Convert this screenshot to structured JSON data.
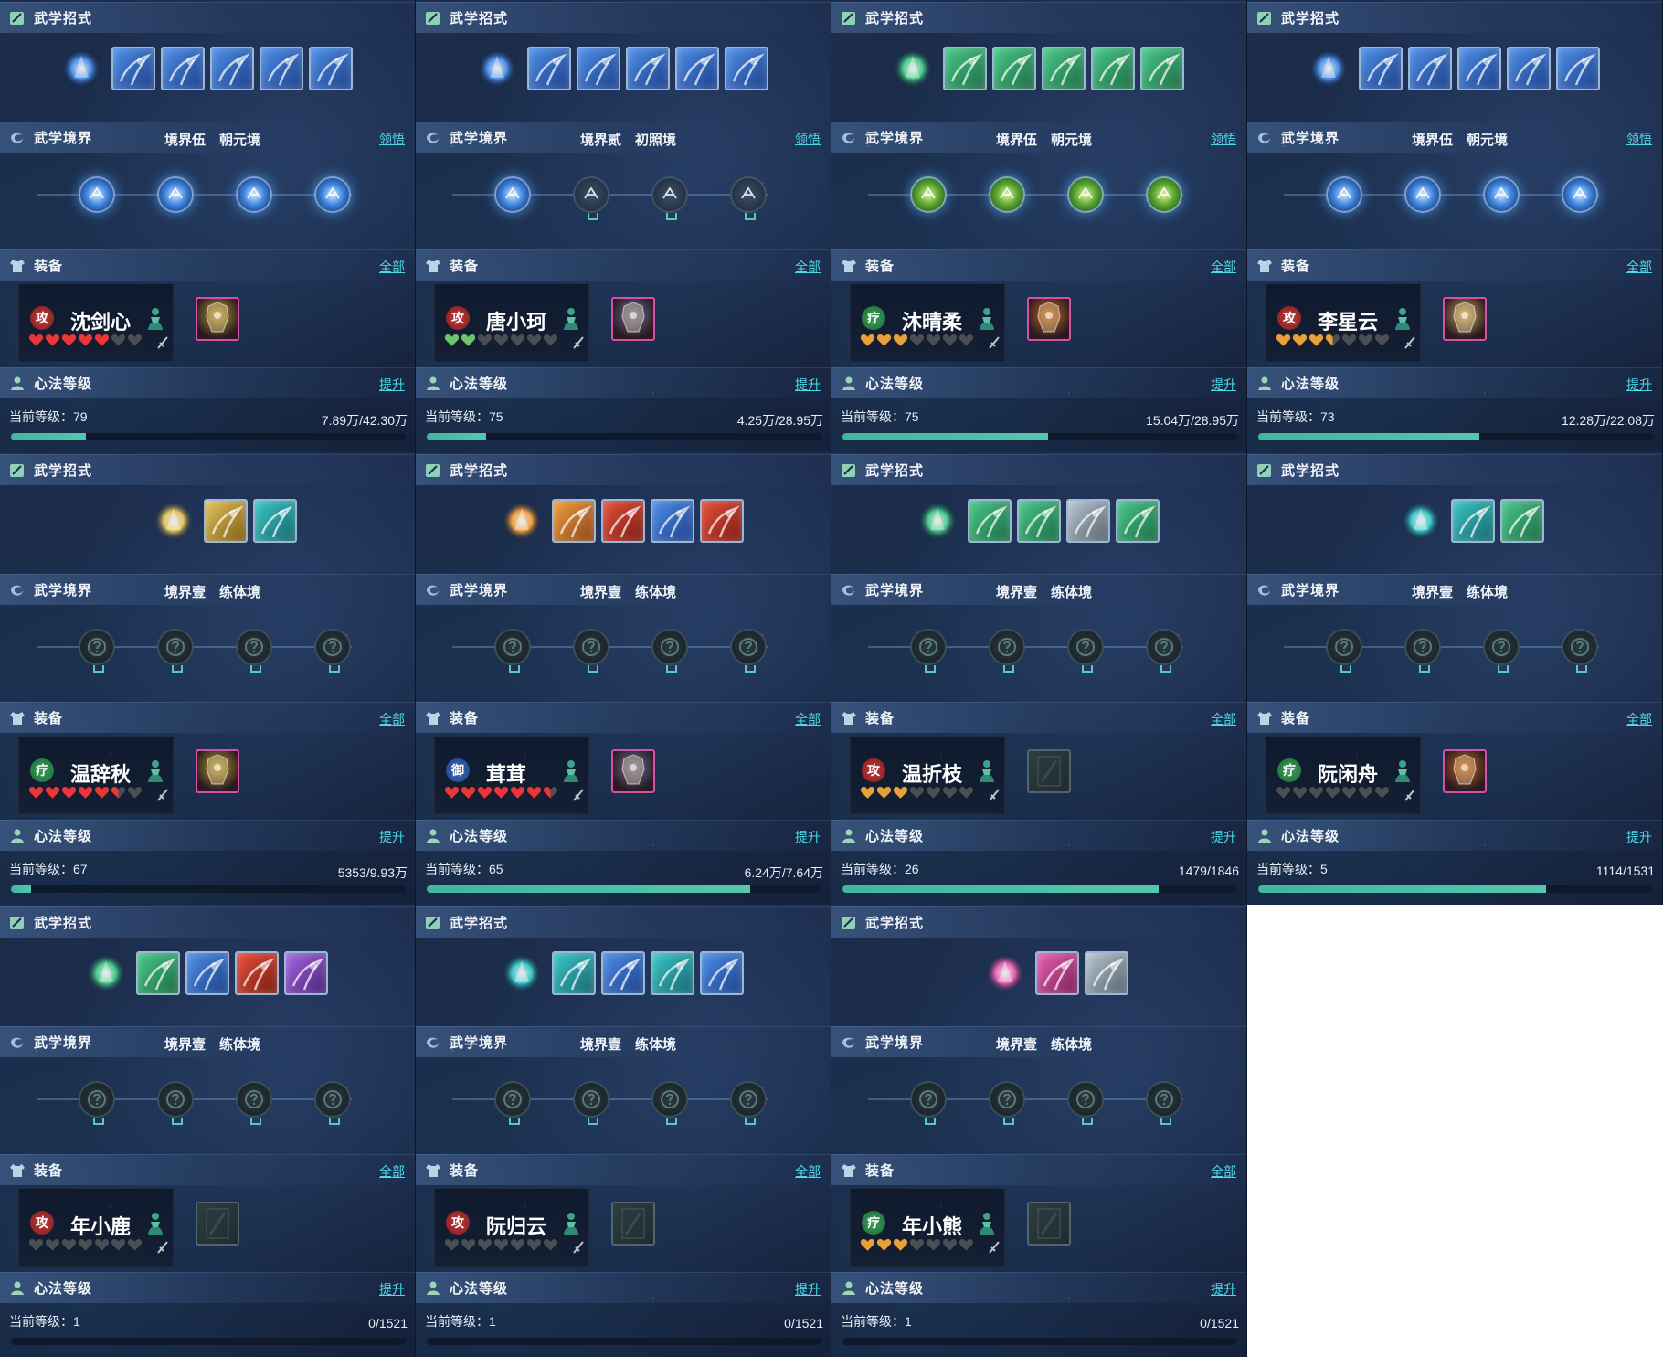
{
  "labels": {
    "skills": "武学招式",
    "realm": "武学境界",
    "realm_link": "领悟",
    "equip": "装备",
    "equip_link": "全部",
    "heart_method": "心法等级",
    "heart_link": "提升",
    "level_prefix": "当前等级："
  },
  "colors": {
    "accent_link": "#4fd9e8",
    "progress_fill": "#4fbfa6",
    "heart_red": "#e8383a",
    "heart_green": "#6ec46a",
    "heart_gold": "#e7a13a",
    "heart_empty": "#4a4f57"
  },
  "panels": [
    {
      "name": "沈剑心",
      "role": "attack",
      "role_char": "攻",
      "realm": "境界伍",
      "realm_stage": "朝元境",
      "show_realm_link": true,
      "level": "79",
      "exp": "7.89万/42.30万",
      "progress": 0.19,
      "hearts": {
        "filled": 5,
        "half": 0,
        "total": 7,
        "color": "red"
      },
      "armor": "has",
      "armor_color": "#b39a30",
      "char_icon": "ice-orb",
      "skill_icons": [
        "blue",
        "blue",
        "blue",
        "blue",
        "blue"
      ],
      "realm_nodes": [
        "active",
        "active",
        "active",
        "active"
      ]
    },
    {
      "name": "唐小珂",
      "role": "attack",
      "role_char": "攻",
      "realm": "境界贰",
      "realm_stage": "初照境",
      "show_realm_link": true,
      "level": "75",
      "exp": "4.25万/28.95万",
      "progress": 0.15,
      "hearts": {
        "filled": 2,
        "half": 0,
        "total": 7,
        "color": "green"
      },
      "armor": "has",
      "armor_color": "#6a6f9a",
      "char_icon": "bird",
      "skill_icons": [
        "blue",
        "blue",
        "blue",
        "blue",
        "blue"
      ],
      "realm_nodes": [
        "active",
        "dim",
        "dim",
        "dim"
      ]
    },
    {
      "name": "沐晴柔",
      "role": "heal",
      "role_char": "疗",
      "realm": "境界伍",
      "realm_stage": "朝元境",
      "show_realm_link": true,
      "level": "75",
      "exp": "15.04万/28.95万",
      "progress": 0.52,
      "hearts": {
        "filled": 3,
        "half": 0,
        "total": 7,
        "color": "gold"
      },
      "armor": "has",
      "armor_color": "#c4661e",
      "char_icon": "dancer",
      "skill_icons": [
        "green",
        "green",
        "green",
        "green",
        "green"
      ],
      "realm_nodes": [
        "active-green",
        "active-green",
        "active-green",
        "active-green"
      ]
    },
    {
      "name": "李星云",
      "role": "attack",
      "role_char": "攻",
      "realm": "境界伍",
      "realm_stage": "朝元境",
      "show_realm_link": true,
      "level": "73",
      "exp": "12.28万/22.08万",
      "progress": 0.56,
      "hearts": {
        "filled": 3,
        "half": 1,
        "total": 7,
        "color": "gold"
      },
      "armor": "has",
      "armor_color": "#c7a25a",
      "char_icon": "warrior",
      "skill_icons": [
        "blue",
        "blue",
        "blue",
        "blue",
        "blue"
      ],
      "realm_nodes": [
        "active",
        "active",
        "active",
        "active"
      ]
    },
    {
      "name": "温辞秋",
      "role": "heal",
      "role_char": "疗",
      "realm": "境界壹",
      "realm_stage": "练体境",
      "show_realm_link": false,
      "level": "67",
      "exp": "5353/9.93万",
      "progress": 0.05,
      "hearts": {
        "filled": 5,
        "half": 1,
        "total": 7,
        "color": "red"
      },
      "armor": "has",
      "armor_color": "#b39a30",
      "char_icon": "purple-figure",
      "skill_icons": [
        "gold",
        "teal"
      ],
      "realm_nodes": [
        "locked",
        "locked",
        "locked",
        "locked"
      ]
    },
    {
      "name": "茸茸",
      "role": "defend",
      "role_char": "御",
      "realm": "境界壹",
      "realm_stage": "练体境",
      "show_realm_link": false,
      "level": "65",
      "exp": "6.24万/7.64万",
      "progress": 0.82,
      "hearts": {
        "filled": 6,
        "half": 1,
        "total": 7,
        "color": "red"
      },
      "armor": "has",
      "armor_color": "#6a6f9a",
      "char_icon": "fire-figure",
      "skill_icons": [
        "orange",
        "red",
        "blue",
        "red"
      ],
      "realm_nodes": [
        "locked",
        "locked",
        "locked",
        "locked"
      ]
    },
    {
      "name": "温折枝",
      "role": "attack",
      "role_char": "攻",
      "realm": "境界壹",
      "realm_stage": "练体境",
      "show_realm_link": false,
      "level": "26",
      "exp": "1479/1846",
      "progress": 0.8,
      "hearts": {
        "filled": 3,
        "half": 0,
        "total": 7,
        "color": "gold"
      },
      "armor": "empty",
      "armor_color": "",
      "char_icon": "green-figure",
      "skill_icons": [
        "green",
        "green",
        "silver",
        "green"
      ],
      "realm_nodes": [
        "locked",
        "locked",
        "locked",
        "locked"
      ]
    },
    {
      "name": "阮闲舟",
      "role": "heal",
      "role_char": "疗",
      "realm": "境界壹",
      "realm_stage": "练体境",
      "show_realm_link": false,
      "level": "5",
      "exp": "1114/1531",
      "progress": 0.73,
      "hearts": {
        "filled": 0,
        "half": 0,
        "total": 7,
        "color": "gold"
      },
      "armor": "has",
      "armor_color": "#c4661e",
      "char_icon": "leaf",
      "skill_icons": [
        "teal",
        "green"
      ],
      "realm_nodes": [
        "locked",
        "locked",
        "locked",
        "locked"
      ]
    },
    {
      "name": "年小鹿",
      "role": "attack",
      "role_char": "攻",
      "realm": "境界壹",
      "realm_stage": "练体境",
      "show_realm_link": false,
      "level": "1",
      "exp": "0/1521",
      "progress": 0,
      "hearts": {
        "filled": 0,
        "half": 0,
        "total": 7,
        "color": "gold"
      },
      "armor": "empty",
      "armor_color": "",
      "char_icon": "pink-orb",
      "skill_icons": [
        "green",
        "blue",
        "red",
        "purple"
      ],
      "realm_nodes": [
        "locked",
        "locked",
        "locked",
        "locked"
      ]
    },
    {
      "name": "阮归云",
      "role": "attack",
      "role_char": "攻",
      "realm": "境界壹",
      "realm_stage": "练体境",
      "show_realm_link": false,
      "level": "1",
      "exp": "0/1521",
      "progress": 0,
      "hearts": {
        "filled": 0,
        "half": 0,
        "total": 7,
        "color": "gold"
      },
      "armor": "empty",
      "armor_color": "",
      "char_icon": "blue-swirl",
      "skill_icons": [
        "teal",
        "blue",
        "teal",
        "blue"
      ],
      "realm_nodes": [
        "locked",
        "locked",
        "locked",
        "locked"
      ]
    },
    {
      "name": "年小熊",
      "role": "heal",
      "role_char": "疗",
      "realm": "境界壹",
      "realm_stage": "练体境",
      "show_realm_link": false,
      "level": "1",
      "exp": "0/1521",
      "progress": 0,
      "hearts": {
        "filled": 3,
        "half": 0,
        "total": 7,
        "color": "gold"
      },
      "armor": "empty",
      "armor_color": "",
      "char_icon": "violet-bell",
      "skill_icons": [
        "pink",
        "silver"
      ],
      "realm_nodes": [
        "locked",
        "locked",
        "locked",
        "locked"
      ]
    }
  ]
}
